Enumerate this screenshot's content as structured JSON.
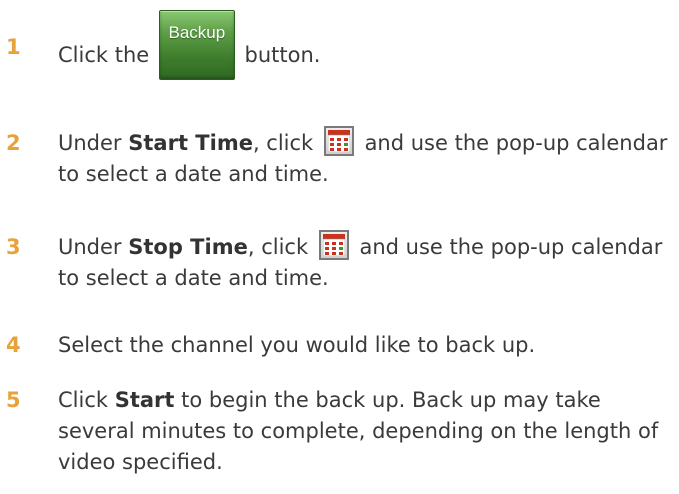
{
  "steps": [
    {
      "number": "1",
      "pre": "Click the ",
      "button_label": "Backup",
      "post": " button."
    },
    {
      "number": "2",
      "pre": "Under ",
      "bold": "Start Time",
      "mid": ", click ",
      "post": " and use the pop-up calendar to select a date and time.",
      "icon": "calendar-icon"
    },
    {
      "number": "3",
      "pre": "Under ",
      "bold": "Stop Time",
      "mid": ", click ",
      "post": " and use the pop-up calendar to select a date and time.",
      "icon": "calendar-icon"
    },
    {
      "number": "4",
      "text": "Select the channel you would like to back up."
    },
    {
      "number": "5",
      "pre": "Click ",
      "bold": "Start",
      "post": " to begin the back up. Back up may take several minutes to complete, depending on the length of video specified."
    }
  ],
  "colors": {
    "step_number": "#e8a23a",
    "body_text": "#3a3a3a",
    "button_green": "#4e8e3a",
    "calendar_red": "#c8321e",
    "calendar_green": "#3c9a2a"
  }
}
